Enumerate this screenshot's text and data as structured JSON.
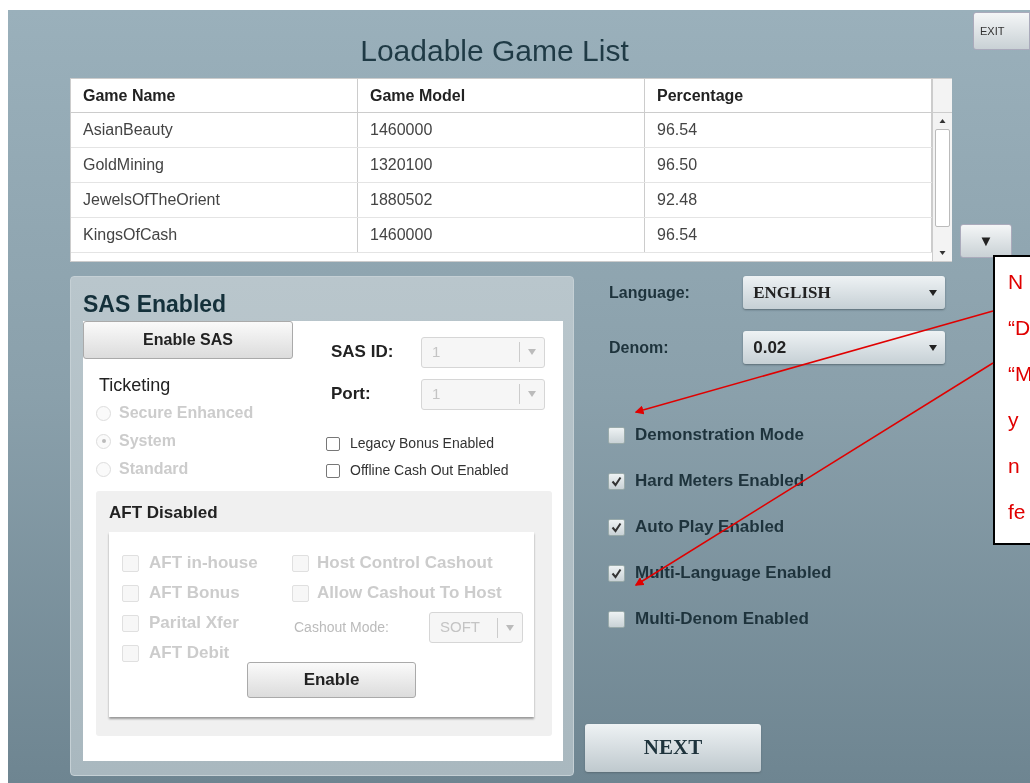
{
  "exit_button": "EXIT",
  "title": "Loadable Game List",
  "table": {
    "columns": [
      "Game Name",
      "Game Model",
      "Percentage"
    ],
    "rows": [
      [
        "AsianBeauty",
        "1460000",
        "96.54"
      ],
      [
        "GoldMining",
        "1320100",
        "96.50"
      ],
      [
        "JewelsOfTheOrient",
        "1880502",
        "92.48"
      ],
      [
        "KingsOfCash",
        "1460000",
        "96.54"
      ]
    ]
  },
  "scroll_down_button": "▼",
  "sas_panel": {
    "title": "SAS Enabled",
    "enable_button": "Enable SAS",
    "ticketing": {
      "label": "Ticketing",
      "disabled": true,
      "options": [
        {
          "label": "Secure Enhanced",
          "selected": false
        },
        {
          "label": "System",
          "selected": true
        },
        {
          "label": "Standard",
          "selected": false
        }
      ]
    },
    "sas_id": {
      "label": "SAS ID:",
      "value": "1",
      "disabled": true
    },
    "port": {
      "label": "Port:",
      "value": "1",
      "disabled": true
    },
    "options": [
      {
        "label": "Legacy Bonus Enabled",
        "checked": false
      },
      {
        "label": "Offline Cash Out Enabled",
        "checked": false
      }
    ],
    "aft": {
      "title": "AFT Disabled",
      "disabled": true,
      "options_left": [
        {
          "label": "AFT in-house",
          "checked": false
        },
        {
          "label": "AFT Bonus",
          "checked": false
        },
        {
          "label": "Parital Xfer",
          "checked": false
        },
        {
          "label": "AFT Debit",
          "checked": false
        }
      ],
      "options_right": [
        {
          "label": "Host Control Cashout",
          "checked": false
        },
        {
          "label": "Allow Cashout To Host",
          "checked": false
        }
      ],
      "cashout_mode": {
        "label": "Cashout Mode:",
        "value": "SOFT"
      },
      "enable_button": "Enable"
    }
  },
  "language": {
    "label": "Language:",
    "value": "ENGLISH"
  },
  "denom": {
    "label": "Denom:",
    "value": "0.02"
  },
  "settings": [
    {
      "label": "Demonstration Mode",
      "checked": false
    },
    {
      "label": "Hard Meters Enabled",
      "checked": true
    },
    {
      "label": "Auto Play Enabled",
      "checked": true
    },
    {
      "label": "Multi-Language Enabled",
      "checked": true
    },
    {
      "label": "Multi-Denom Enabled",
      "checked": false
    }
  ],
  "next_button": "NEXT",
  "annotation": {
    "lines": [
      "N",
      "“D",
      "“M",
      "y",
      "n",
      "fe"
    ]
  }
}
